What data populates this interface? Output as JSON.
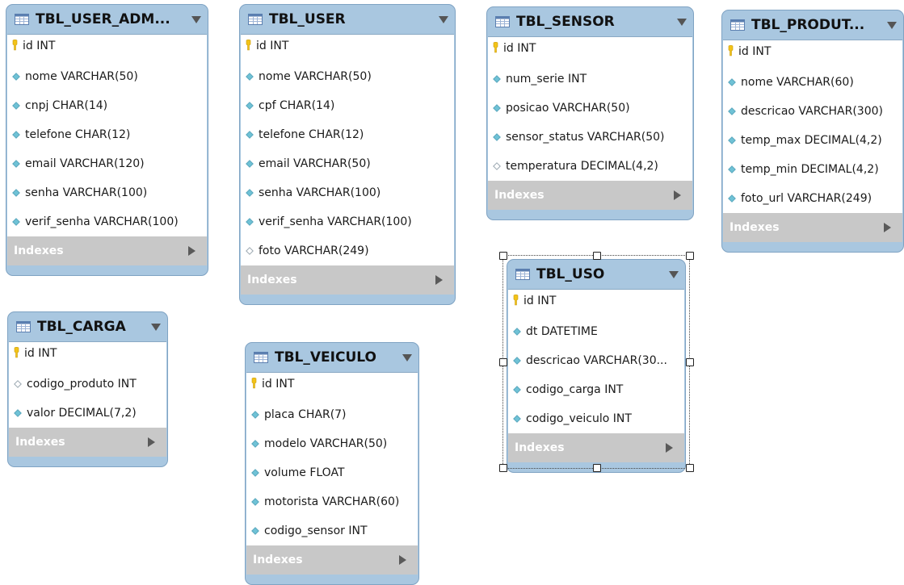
{
  "tables": [
    {
      "id": "tbl_user_admin",
      "title": "TBL_USER_ADM...",
      "columns": [
        {
          "text": "id INT",
          "type": "pk"
        },
        {
          "text": "nome VARCHAR(50)",
          "type": "nn"
        },
        {
          "text": "cnpj CHAR(14)",
          "type": "nn"
        },
        {
          "text": "telefone CHAR(12)",
          "type": "nn"
        },
        {
          "text": "email VARCHAR(120)",
          "type": "nn"
        },
        {
          "text": "senha VARCHAR(100)",
          "type": "nn"
        },
        {
          "text": "verif_senha VARCHAR(100)",
          "type": "nn"
        }
      ],
      "indexes_label": "Indexes"
    },
    {
      "id": "tbl_user",
      "title": "TBL_USER",
      "columns": [
        {
          "text": "id INT",
          "type": "pk"
        },
        {
          "text": "nome VARCHAR(50)",
          "type": "nn"
        },
        {
          "text": "cpf CHAR(14)",
          "type": "nn"
        },
        {
          "text": "telefone CHAR(12)",
          "type": "nn"
        },
        {
          "text": "email VARCHAR(50)",
          "type": "nn"
        },
        {
          "text": "senha VARCHAR(100)",
          "type": "nn"
        },
        {
          "text": "verif_senha VARCHAR(100)",
          "type": "nn"
        },
        {
          "text": "foto VARCHAR(249)",
          "type": "null"
        }
      ],
      "indexes_label": "Indexes"
    },
    {
      "id": "tbl_sensor",
      "title": "TBL_SENSOR",
      "columns": [
        {
          "text": "id INT",
          "type": "pk"
        },
        {
          "text": "num_serie INT",
          "type": "nn"
        },
        {
          "text": "posicao VARCHAR(50)",
          "type": "nn"
        },
        {
          "text": "sensor_status VARCHAR(50)",
          "type": "nn"
        },
        {
          "text": "temperatura DECIMAL(4,2)",
          "type": "null"
        }
      ],
      "indexes_label": "Indexes"
    },
    {
      "id": "tbl_produto",
      "title": "TBL_PRODUT...",
      "columns": [
        {
          "text": "id INT",
          "type": "pk"
        },
        {
          "text": "nome VARCHAR(60)",
          "type": "nn"
        },
        {
          "text": "descricao VARCHAR(300)",
          "type": "nn"
        },
        {
          "text": "temp_max DECIMAL(4,2)",
          "type": "nn"
        },
        {
          "text": "temp_min DECIMAL(4,2)",
          "type": "nn"
        },
        {
          "text": "foto_url VARCHAR(249)",
          "type": "nn"
        }
      ],
      "indexes_label": "Indexes"
    },
    {
      "id": "tbl_carga",
      "title": "TBL_CARGA",
      "columns": [
        {
          "text": "id INT",
          "type": "pk"
        },
        {
          "text": "codigo_produto INT",
          "type": "null"
        },
        {
          "text": "valor DECIMAL(7,2)",
          "type": "nn"
        }
      ],
      "indexes_label": "Indexes"
    },
    {
      "id": "tbl_veiculo",
      "title": "TBL_VEICULO",
      "columns": [
        {
          "text": "id INT",
          "type": "pk"
        },
        {
          "text": "placa CHAR(7)",
          "type": "nn"
        },
        {
          "text": "modelo VARCHAR(50)",
          "type": "nn"
        },
        {
          "text": "volume FLOAT",
          "type": "nn"
        },
        {
          "text": "motorista VARCHAR(60)",
          "type": "nn"
        },
        {
          "text": "codigo_sensor INT",
          "type": "nn"
        }
      ],
      "indexes_label": "Indexes"
    },
    {
      "id": "tbl_uso",
      "title": "TBL_USO",
      "columns": [
        {
          "text": "id INT",
          "type": "pk"
        },
        {
          "text": "dt DATETIME",
          "type": "nn"
        },
        {
          "text": "descricao VARCHAR(30...",
          "type": "nn"
        },
        {
          "text": "codigo_carga INT",
          "type": "nn"
        },
        {
          "text": "codigo_veiculo INT",
          "type": "nn"
        }
      ],
      "indexes_label": "Indexes"
    }
  ],
  "selected_table": "tbl_uso",
  "icons": {
    "table": "table-icon",
    "primary_key": "key-icon",
    "not_null_column": "filled-diamond-icon",
    "nullable_column": "hollow-diamond-icon",
    "collapse": "dropdown-icon",
    "expand": "expand-arrow-icon"
  },
  "colors": {
    "header": "#a9c7e0",
    "border": "#7fa3c3",
    "indexes_bar": "#c8c8c8",
    "key": "#f2c318",
    "diamond_fill": "#6fc2d6",
    "diamond_stroke": "#5aa7bd"
  }
}
